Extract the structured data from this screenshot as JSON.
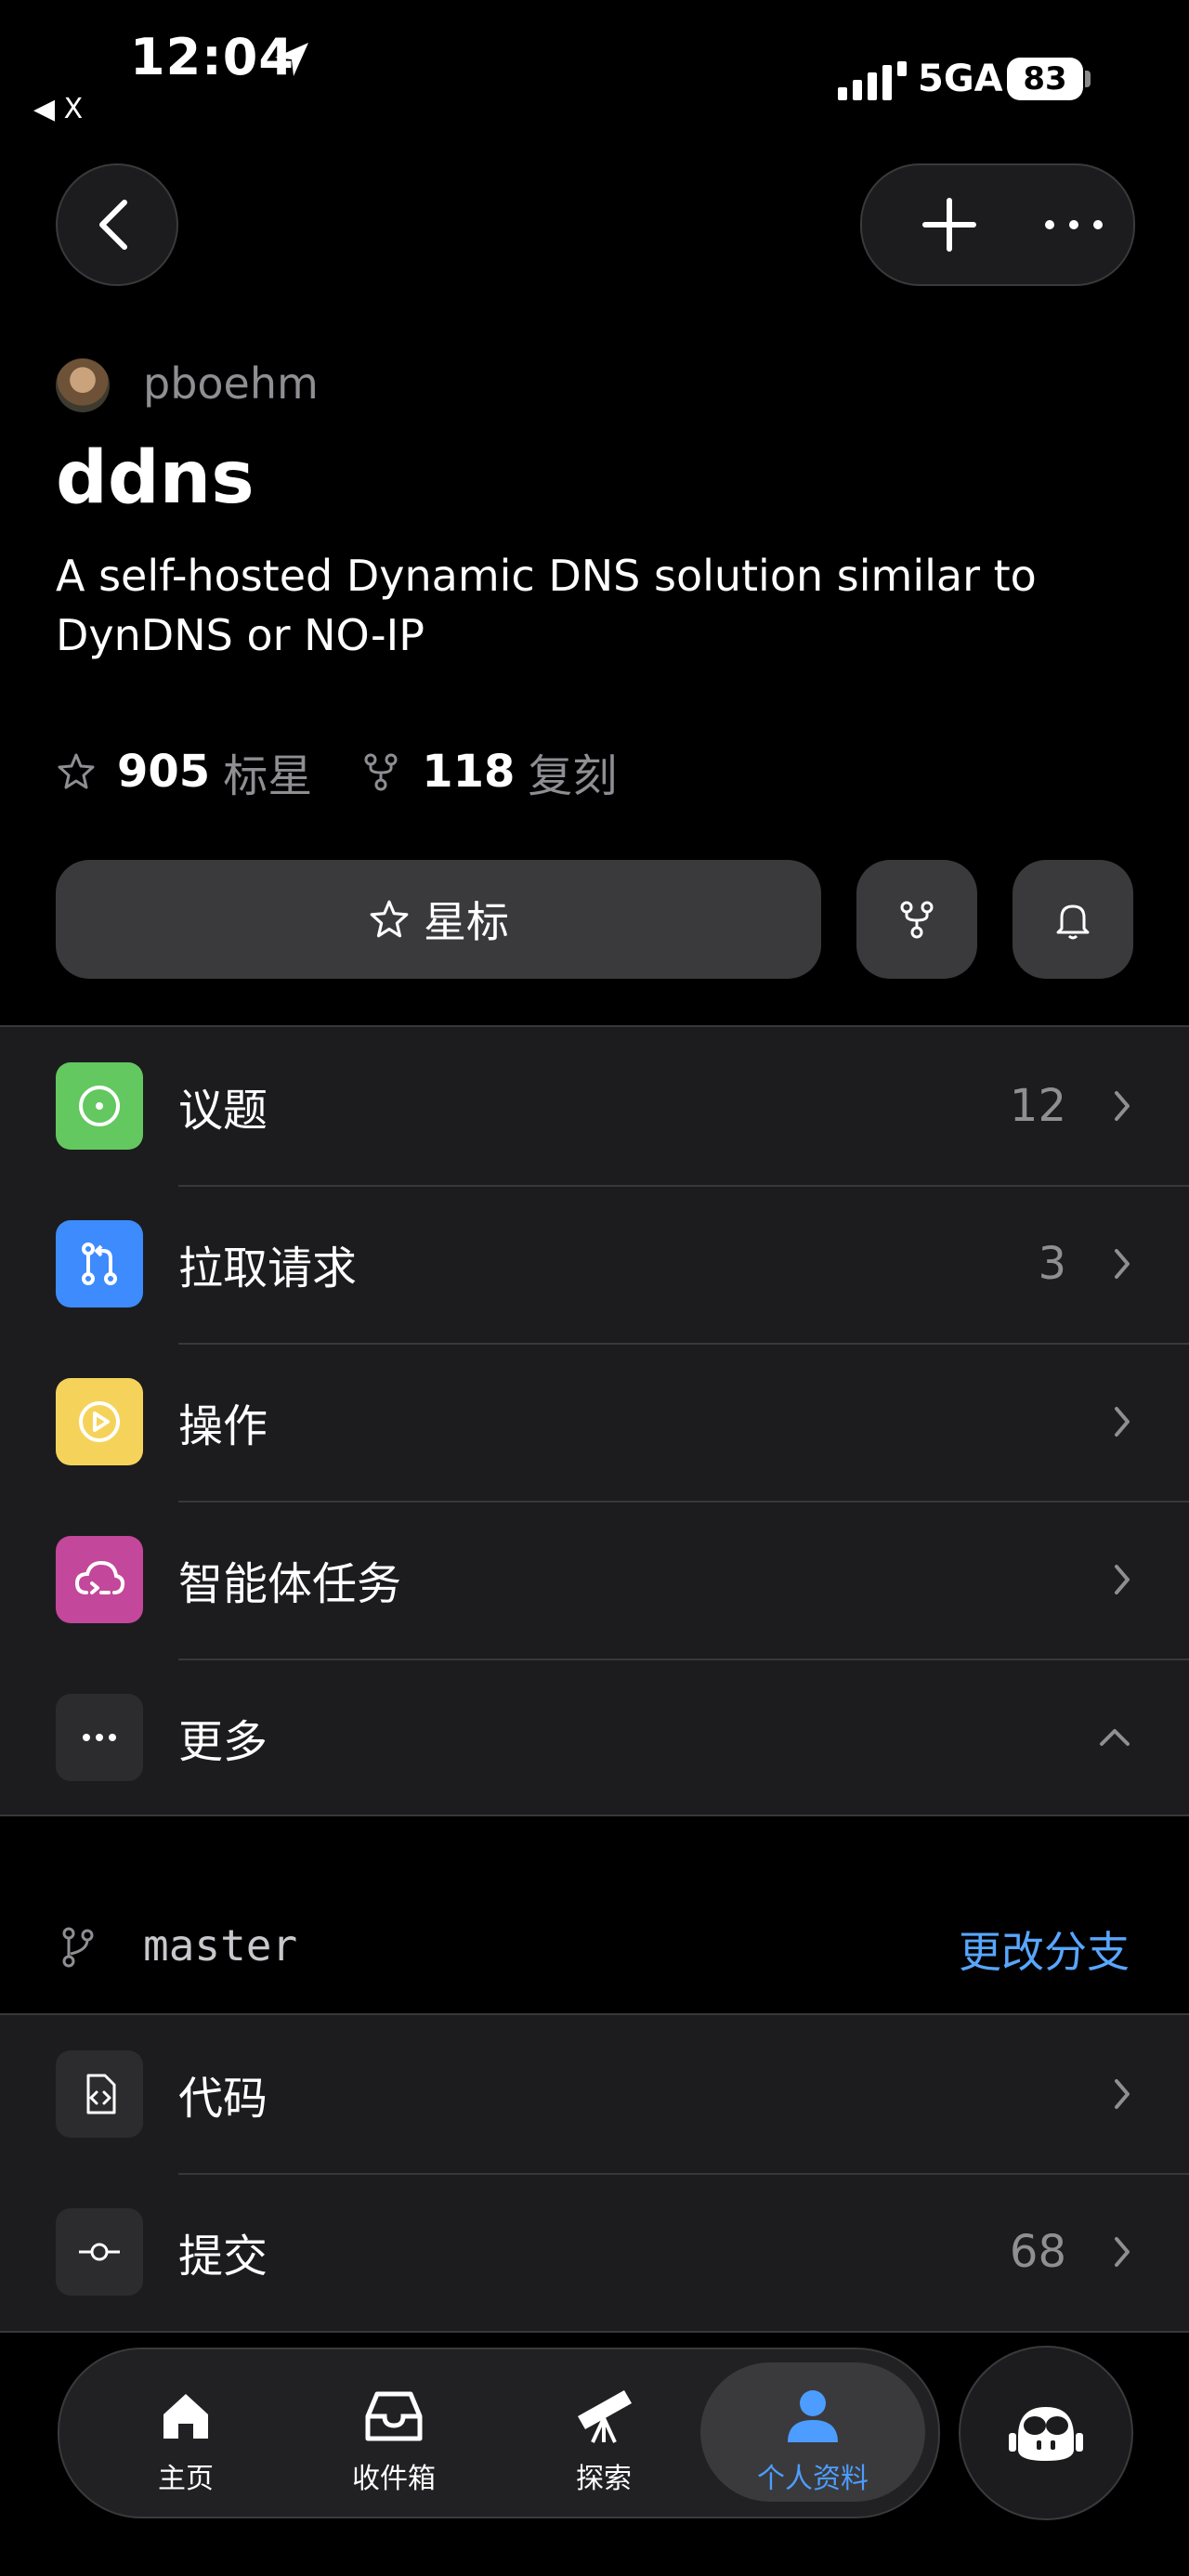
{
  "status_bar": {
    "time": "12:04",
    "back_app": "◀ X",
    "network": "5GA",
    "battery": "83"
  },
  "repo": {
    "owner": "pboehm",
    "name": "ddns",
    "description": "A self-hosted Dynamic DNS solution similar to DynDNS or NO-IP",
    "stars_count": "905",
    "stars_label": "标星",
    "forks_count": "118",
    "forks_label": "复刻",
    "star_button_label": "星标"
  },
  "menu": [
    {
      "label": "议题",
      "count": "12",
      "color": "#63c85f",
      "icon": "issue-icon"
    },
    {
      "label": "拉取请求",
      "count": "3",
      "color": "#3d8bfd",
      "icon": "pull-request-icon"
    },
    {
      "label": "操作",
      "count": "",
      "color": "#f5d35b",
      "icon": "actions-play-icon"
    },
    {
      "label": "智能体任务",
      "count": "",
      "color": "#c3479a",
      "icon": "agent-cloud-icon"
    },
    {
      "label": "更多",
      "count": "",
      "color": "#2c2c2e",
      "icon": "more-dots-icon"
    }
  ],
  "branch": {
    "name": "master",
    "change_label": "更改分支"
  },
  "code_menu": [
    {
      "label": "代码",
      "count": "",
      "icon": "code-file-icon"
    },
    {
      "label": "提交",
      "count": "68",
      "icon": "commit-icon"
    }
  ],
  "tabbar": {
    "tabs": [
      {
        "label": "主页",
        "icon": "home-icon"
      },
      {
        "label": "收件箱",
        "icon": "inbox-icon"
      },
      {
        "label": "探索",
        "icon": "telescope-icon"
      },
      {
        "label": "个人资料",
        "icon": "person-icon",
        "active": true
      }
    ],
    "accent": "#4c9dff"
  }
}
